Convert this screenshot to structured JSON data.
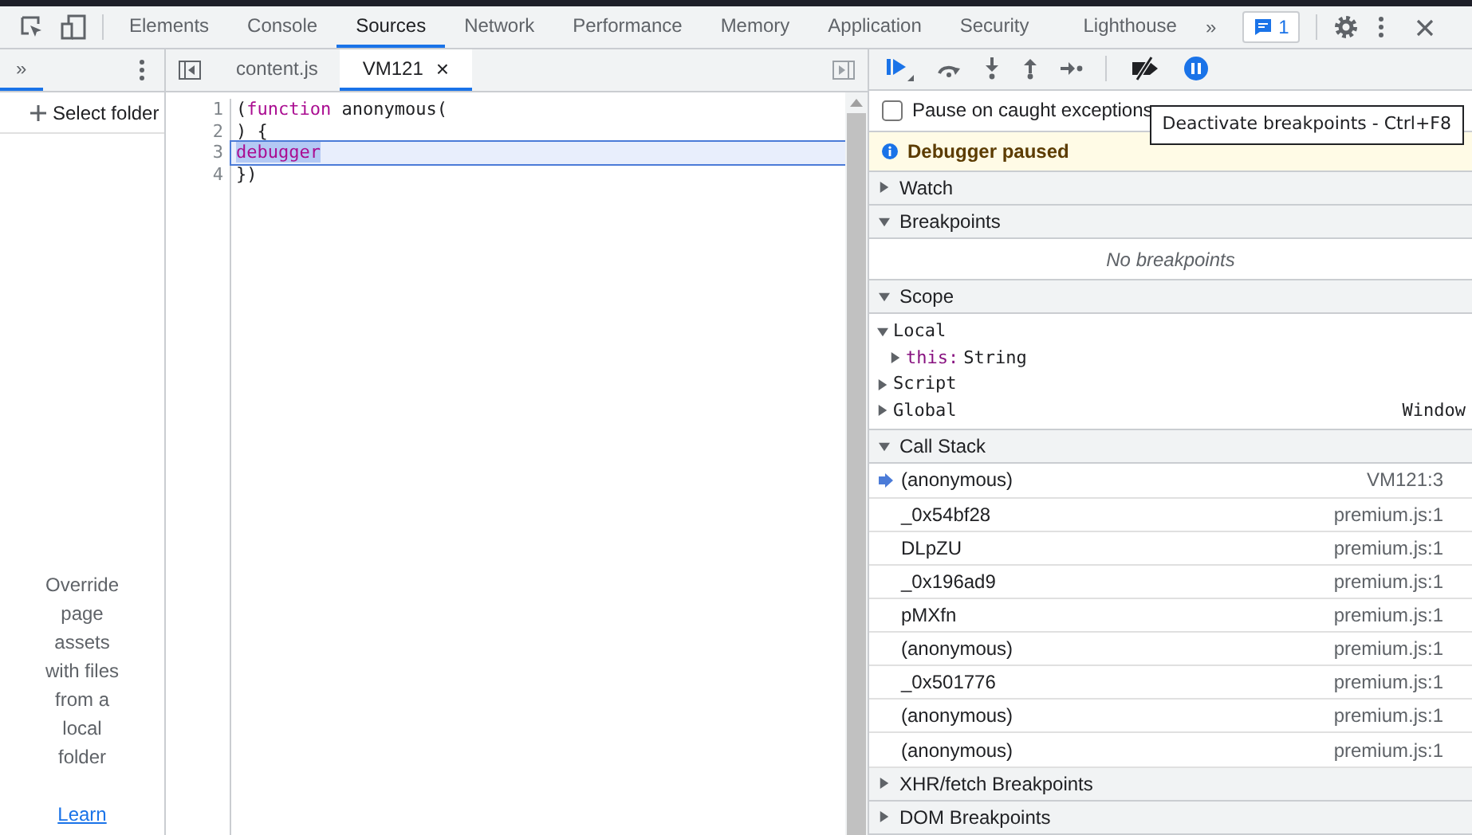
{
  "main_tabs": [
    {
      "label": "Elements",
      "selected": false
    },
    {
      "label": "Console",
      "selected": false
    },
    {
      "label": "Sources",
      "selected": true
    },
    {
      "label": "Network",
      "selected": false
    },
    {
      "label": "Performance",
      "selected": false
    },
    {
      "label": "Memory",
      "selected": false
    },
    {
      "label": "Application",
      "selected": false
    },
    {
      "label": "Security",
      "selected": false
    },
    {
      "label": "Lighthouse",
      "selected": false
    }
  ],
  "more_tabs": "»",
  "issues_badge": "1",
  "navigator": {
    "more": "»",
    "select_folder": "Select folder",
    "message": "Override page assets with files from a local folder",
    "link": "Learn"
  },
  "editor_tabs": [
    {
      "label": "content.js",
      "selected": false,
      "closable": false
    },
    {
      "label": "VM121",
      "selected": true,
      "closable": true
    }
  ],
  "close_glyph": "×",
  "code_lines": [
    {
      "number": "1",
      "current": false,
      "tokens": [
        {
          "text": "(",
          "kind": "plain",
          "selected": false
        },
        {
          "text": "function",
          "kind": "keyword",
          "selected": false
        },
        {
          "text": " anonymous(",
          "kind": "plain",
          "selected": false
        }
      ]
    },
    {
      "number": "2",
      "current": false,
      "tokens": [
        {
          "text": ") {",
          "kind": "plain",
          "selected": false
        }
      ]
    },
    {
      "number": "3",
      "current": true,
      "tokens": [
        {
          "text": "debugger",
          "kind": "keyword",
          "selected": true
        }
      ]
    },
    {
      "number": "4",
      "current": false,
      "tokens": [
        {
          "text": "})",
          "kind": "plain",
          "selected": false
        }
      ]
    }
  ],
  "pause_on_caught": {
    "label": "Pause on caught exceptions",
    "checked": false
  },
  "tooltip": "Deactivate breakpoints - Ctrl+F8",
  "paused_banner": "Debugger paused",
  "watch": {
    "title": "Watch",
    "expanded": false
  },
  "breakpoints": {
    "title": "Breakpoints",
    "expanded": true,
    "empty": "No breakpoints"
  },
  "scope": {
    "title": "Scope",
    "expanded": true,
    "items": [
      {
        "name": "Local",
        "expanded": true,
        "value": "",
        "children": [
          {
            "name": "this:",
            "value": "String",
            "expanded": false
          }
        ]
      },
      {
        "name": "Script",
        "expanded": false,
        "value": ""
      },
      {
        "name": "Global",
        "expanded": false,
        "value": "Window"
      }
    ]
  },
  "call_stack": {
    "title": "Call Stack",
    "expanded": true,
    "frames": [
      {
        "name": "(anonymous)",
        "location": "VM121:3",
        "current": true
      },
      {
        "name": "_0x54bf28",
        "location": "premium.js:1",
        "current": false
      },
      {
        "name": "DLpZU",
        "location": "premium.js:1",
        "current": false
      },
      {
        "name": "_0x196ad9",
        "location": "premium.js:1",
        "current": false
      },
      {
        "name": "pMXfn",
        "location": "premium.js:1",
        "current": false
      },
      {
        "name": "(anonymous)",
        "location": "premium.js:1",
        "current": false
      },
      {
        "name": "_0x501776",
        "location": "premium.js:1",
        "current": false
      },
      {
        "name": "(anonymous)",
        "location": "premium.js:1",
        "current": false
      },
      {
        "name": "(anonymous)",
        "location": "premium.js:1",
        "current": false
      }
    ]
  },
  "xhr_breakpoints": {
    "title": "XHR/fetch Breakpoints",
    "expanded": false
  },
  "dom_breakpoints": {
    "title": "DOM Breakpoints",
    "expanded": false
  }
}
